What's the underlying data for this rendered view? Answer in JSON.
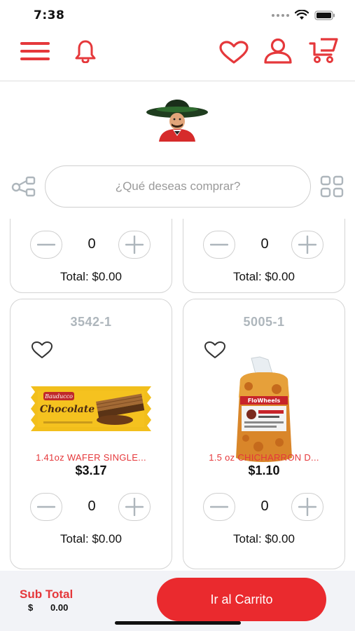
{
  "status": {
    "time": "7:38"
  },
  "search": {
    "placeholder": "¿Qué deseas comprar?"
  },
  "top_cards": [
    {
      "qty": "0",
      "total": "Total: $0.00"
    },
    {
      "qty": "0",
      "total": "Total: $0.00"
    }
  ],
  "products": [
    {
      "sku": "3542-1",
      "name": "1.41oz WAFER SINGLE...",
      "price": "$3.17",
      "qty": "0",
      "total": "Total: $0.00",
      "image": "wafer-chocolate",
      "wrapper_text": "Chocolate",
      "brand_text": "Bauducco"
    },
    {
      "sku": "5005-1",
      "name": "1.5 oz  CHICHARRON D...",
      "price": "$1.10",
      "qty": "0",
      "total": "Total: $0.00",
      "image": "chicharron-bag",
      "brand_text": "FloWheels"
    }
  ],
  "bottom": {
    "subtotal_label": "Sub Total",
    "currency": "$",
    "subtotal_value": "0.00",
    "cart_button": "Ir al Carrito"
  },
  "colors": {
    "accent": "#ea2a2e",
    "accent_text": "#e5383b",
    "sku_gray": "#aeb6bc",
    "bottom_bg": "#f2f3f7"
  },
  "icons": {
    "menu": "menu-icon",
    "bell": "bell-icon",
    "heart": "heart-icon",
    "user": "user-icon",
    "cart": "cart-icon",
    "share": "share-icon",
    "grid": "grid-icon"
  }
}
